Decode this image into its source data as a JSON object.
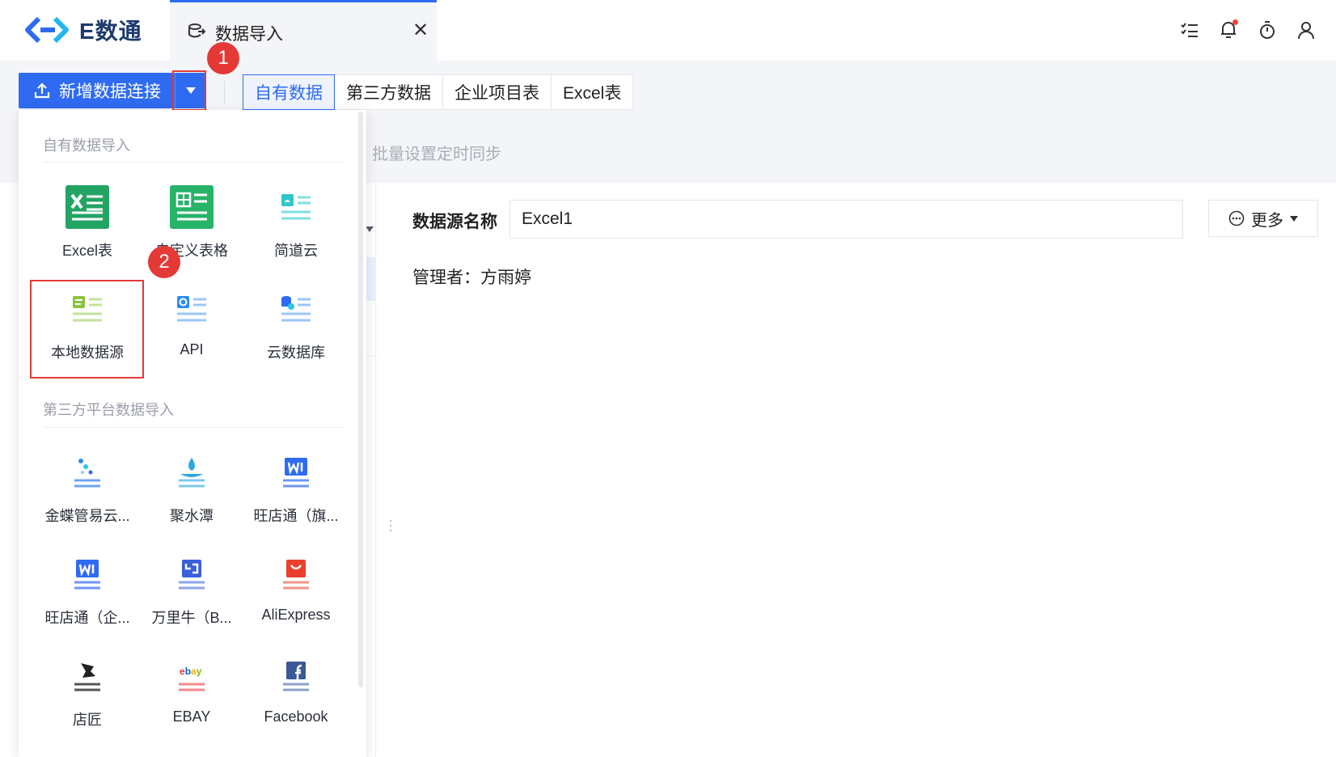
{
  "app": {
    "logo_text": "E数通"
  },
  "tab": {
    "label": "数据导入",
    "close": "✕"
  },
  "toolbar": {
    "add_button_label": "新增数据连接",
    "segment_tabs": [
      "自有数据",
      "第三方数据",
      "企业项目表",
      "Excel表"
    ],
    "sub_action": "批量设置定时同步"
  },
  "annotations": {
    "badge1": "1",
    "badge2": "2"
  },
  "detail": {
    "name_label": "数据源名称",
    "name_value": "Excel1",
    "more_label": "更多",
    "manager": "管理者：方雨婷"
  },
  "dropdown": {
    "section_own": "自有数据导入",
    "own_items": [
      "Excel表",
      "自定义表格",
      "简道云",
      "本地数据源",
      "API",
      "云数据库"
    ],
    "section_third": "第三方平台数据导入",
    "third_items": [
      "金蝶管易云...",
      "聚水潭",
      "旺店通（旗...",
      "旺店通（企...",
      "万里牛（B...",
      "AliExpress",
      "店匠",
      "EBAY",
      "Facebook"
    ]
  },
  "colors": {
    "primary": "#2f6bf2",
    "annotation_red": "#e53935",
    "excel_green": "#21a464"
  }
}
